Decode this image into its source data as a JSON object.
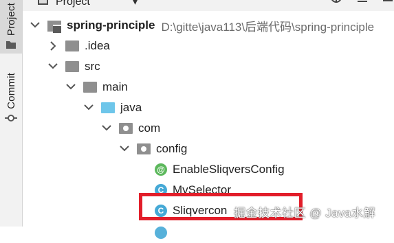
{
  "toolwindow": {
    "title": "Project",
    "tabs": [
      {
        "label": "Project",
        "icon": "folder-icon"
      },
      {
        "label": "Commit",
        "icon": "commit-icon"
      }
    ]
  },
  "tree": {
    "root": {
      "label": "spring-principle",
      "path": "D:\\gitte\\java113\\后端代码\\spring-principle"
    },
    "items": [
      {
        "label": ".idea",
        "icon": "folder-icon",
        "expanded": false
      },
      {
        "label": "src",
        "icon": "folder-icon",
        "expanded": true
      },
      {
        "label": "main",
        "icon": "folder-icon",
        "expanded": true
      },
      {
        "label": "java",
        "icon": "source-folder-icon",
        "expanded": true
      },
      {
        "label": "com",
        "icon": "package-icon",
        "expanded": true
      },
      {
        "label": "config",
        "icon": "package-icon",
        "expanded": true
      },
      {
        "label": "EnableSliqversConfig",
        "icon": "annotation-icon",
        "glyph": "@"
      },
      {
        "label": "MySelector",
        "icon": "class-icon",
        "glyph": "C"
      },
      {
        "label": "Sliqvercon",
        "icon": "class-icon",
        "glyph": "C"
      }
    ]
  },
  "watermark": "掘金技术社区 @ Java水解",
  "colors": {
    "highlight": "#e21e2a",
    "annotation": "#5cb85c",
    "class": "#45a9d6",
    "sourceFolder": "#6ec6ea"
  }
}
